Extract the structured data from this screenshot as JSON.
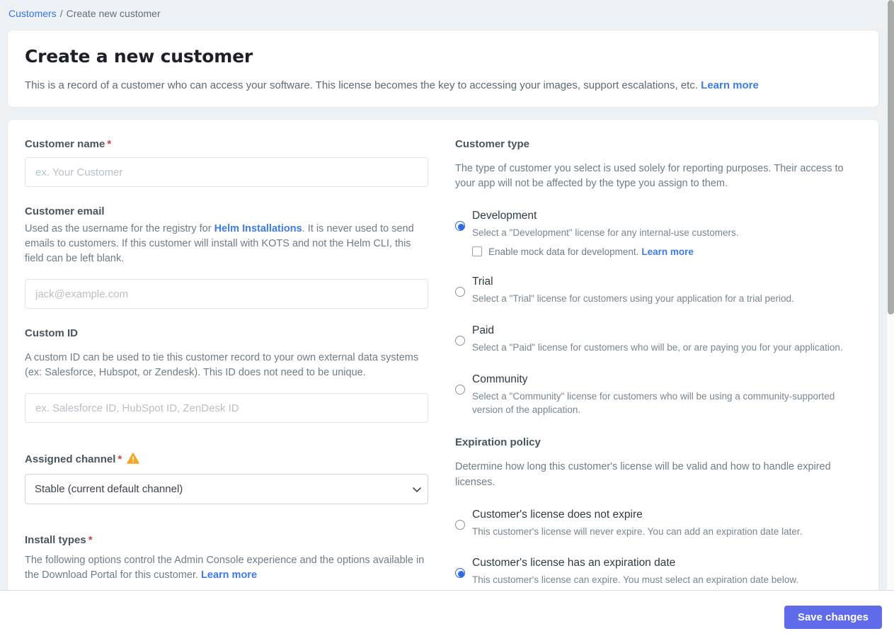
{
  "breadcrumb": {
    "link": "Customers",
    "separator": "/",
    "current": "Create new customer"
  },
  "header": {
    "title": "Create a new customer",
    "description": "This is a record of a customer who can access your software. This license becomes the key to accessing your images, support escalations, etc.",
    "learn_more": "Learn more"
  },
  "form": {
    "customer_name": {
      "label": "Customer name",
      "required": "*",
      "placeholder": "ex. Your Customer"
    },
    "customer_email": {
      "label": "Customer email",
      "desc_before": "Used as the username for the registry for ",
      "desc_link": "Helm Installations",
      "desc_after": ". It is never used to send emails to customers. If this customer will install with KOTS and not the Helm CLI, this field can be left blank.",
      "placeholder": "jack@example.com"
    },
    "custom_id": {
      "label": "Custom ID",
      "description": "A custom ID can be used to tie this customer record to your own external data systems (ex: Salesforce, Hubspot, or Zendesk). This ID does not need to be unique.",
      "placeholder": "ex. Salesforce ID, HubSpot ID, ZenDesk ID"
    },
    "assigned_channel": {
      "label": "Assigned channel",
      "required": "*",
      "warning_icon": "warning-triangle",
      "selected_option": "Stable (current default channel)"
    },
    "install_types": {
      "label": "Install types",
      "required": "*",
      "description": "The following options control the Admin Console experience and the options available in the Download Portal for this customer.",
      "learn_more": "Learn more"
    }
  },
  "customer_type": {
    "label": "Customer type",
    "description": "The type of customer you select is used solely for reporting purposes. Their access to your app will not be affected by the type you assign to them.",
    "options": [
      {
        "title": "Development",
        "description": "Select a \"Development\" license for any internal-use customers.",
        "selected": true,
        "checkbox_label": "Enable mock data for development.",
        "checkbox_learn_more": "Learn more",
        "checkbox_checked": false
      },
      {
        "title": "Trial",
        "description": "Select a \"Trial\" license for customers using your application for a trial period.",
        "selected": false
      },
      {
        "title": "Paid",
        "description": "Select a \"Paid\" license for customers who will be, or are paying you for your application.",
        "selected": false
      },
      {
        "title": "Community",
        "description": "Select a \"Community\" license for customers who will be using a community-supported version of the application.",
        "selected": false
      }
    ]
  },
  "expiration_policy": {
    "label": "Expiration policy",
    "description": "Determine how long this customer's license will be valid and how to handle expired licenses.",
    "options": [
      {
        "title": "Customer's license does not expire",
        "description": "This customer's license will never expire. You can add an expiration date later.",
        "selected": false
      },
      {
        "title": "Customer's license has an expiration date",
        "description": "This customer's license can expire. You must select an expiration date below.",
        "selected": true
      }
    ]
  },
  "footer": {
    "save_label": "Save changes"
  },
  "colors": {
    "accent_link": "#3b7ce8",
    "radio_checked": "#2f6de8",
    "save_button": "#5f6be8",
    "required_red": "#cc4641",
    "warning_amber": "#f5a623",
    "page_background": "#eef1f3"
  }
}
